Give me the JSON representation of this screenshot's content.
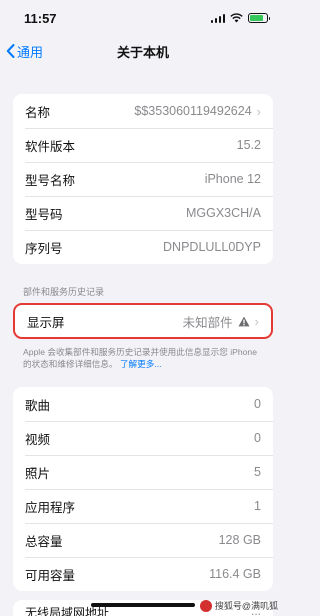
{
  "status": {
    "time": "11:57"
  },
  "nav": {
    "back_label": "通用",
    "title": "关于本机"
  },
  "about": [
    {
      "label": "名称",
      "value": "$$353060119492624",
      "chevron": true
    },
    {
      "label": "软件版本",
      "value": "15.2",
      "chevron": false
    },
    {
      "label": "型号名称",
      "value": "iPhone 12",
      "chevron": false
    },
    {
      "label": "型号码",
      "value": "MGGX3CH/A",
      "chevron": false
    },
    {
      "label": "序列号",
      "value": "DNPDLULL0DYP",
      "chevron": false
    }
  ],
  "history": {
    "header": "部件和服务历史记录",
    "row": {
      "label": "显示屏",
      "value": "未知部件"
    },
    "footnote": "Apple 会收集部件和服务历史记录并使用此信息显示您 iPhone的状态和维修详细信息。",
    "link": "了解更多..."
  },
  "stats": [
    {
      "label": "歌曲",
      "value": "0"
    },
    {
      "label": "视频",
      "value": "0"
    },
    {
      "label": "照片",
      "value": "5"
    },
    {
      "label": "应用程序",
      "value": "1"
    },
    {
      "label": "总容量",
      "value": "128 GB"
    },
    {
      "label": "可用容量",
      "value": "116.4 GB"
    }
  ],
  "partial": {
    "label": "无线局域网地址",
    "value": "..."
  },
  "watermark": {
    "text": "搜狐号@满叽狐"
  },
  "colors": {
    "accent": "#007aff",
    "highlight": "#e53935",
    "battery": "#34c759"
  }
}
